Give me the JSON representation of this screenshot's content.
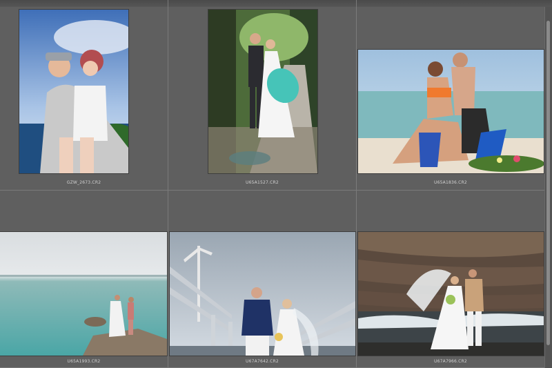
{
  "photos": [
    {
      "filename": "GZW_2673.CR2",
      "scene": "couple-hug-camera-portrait"
    },
    {
      "filename": "U65A1527.CR2",
      "scene": "couple-walk-umbrella-trees"
    },
    {
      "filename": "U65A1836.CR2",
      "scene": "couple-kiss-beach"
    },
    {
      "filename": "U65A1993.CR2",
      "scene": "couple-rock-sea"
    },
    {
      "filename": "U67A7642.CR2",
      "scene": "couple-bridge-windmill"
    },
    {
      "filename": "U67A7966.CR2",
      "scene": "couple-cliff-veil"
    }
  ]
}
